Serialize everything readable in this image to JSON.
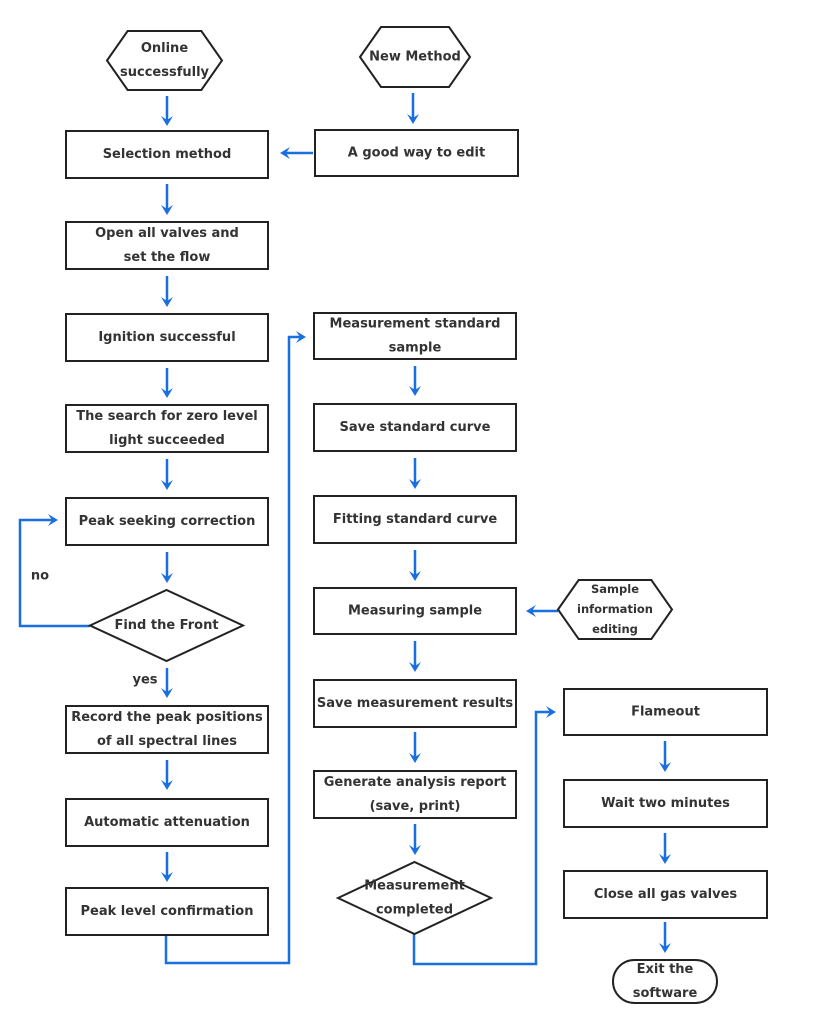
{
  "colors": {
    "arrow": "#1a6fe0",
    "outline": "#222222",
    "text": "#333333"
  },
  "nodes": {
    "online": {
      "shape": "hexagon",
      "lines": [
        "Online",
        "successfully"
      ]
    },
    "new_method": {
      "shape": "hexagon",
      "lines": [
        "New Method"
      ]
    },
    "selection": {
      "shape": "rect",
      "lines": [
        "Selection method"
      ]
    },
    "edit": {
      "shape": "rect",
      "lines": [
        "A good way to edit"
      ]
    },
    "valves": {
      "shape": "rect",
      "lines": [
        "Open all valves and",
        "set the flow"
      ]
    },
    "ignition": {
      "shape": "rect",
      "lines": [
        "Ignition successful"
      ]
    },
    "zero": {
      "shape": "rect",
      "lines": [
        "The search for zero level",
        "light succeeded"
      ]
    },
    "peak_seek": {
      "shape": "rect",
      "lines": [
        "Peak seeking correction"
      ]
    },
    "front": {
      "shape": "diamond",
      "lines": [
        "Find the Front"
      ]
    },
    "record": {
      "shape": "rect",
      "lines": [
        "Record the peak positions",
        "of all spectral lines"
      ]
    },
    "atten": {
      "shape": "rect",
      "lines": [
        "Automatic attenuation"
      ]
    },
    "peak_conf": {
      "shape": "rect",
      "lines": [
        "Peak level confirmation"
      ]
    },
    "std_sample": {
      "shape": "rect",
      "lines": [
        "Measurement standard",
        "sample"
      ]
    },
    "save_curve": {
      "shape": "rect",
      "lines": [
        "Save standard curve"
      ]
    },
    "fit_curve": {
      "shape": "rect",
      "lines": [
        "Fitting standard curve"
      ]
    },
    "measuring": {
      "shape": "rect",
      "lines": [
        "Measuring sample"
      ]
    },
    "sample_info": {
      "shape": "hexagon",
      "lines": [
        "Sample",
        "information",
        "editing"
      ]
    },
    "save_results": {
      "shape": "rect",
      "lines": [
        "Save measurement results"
      ]
    },
    "report": {
      "shape": "rect",
      "lines": [
        "Generate analysis report",
        "(save, print)"
      ]
    },
    "completed": {
      "shape": "diamond",
      "lines": [
        "Measurement",
        "completed"
      ]
    },
    "flameout": {
      "shape": "rect",
      "lines": [
        "Flameout"
      ]
    },
    "wait": {
      "shape": "rect",
      "lines": [
        "Wait two minutes"
      ]
    },
    "close": {
      "shape": "rect",
      "lines": [
        "Close all gas valves"
      ]
    },
    "exit": {
      "shape": "terminal",
      "lines": [
        "Exit the",
        "software"
      ]
    }
  },
  "edge_labels": {
    "no": "no",
    "yes": "yes"
  }
}
